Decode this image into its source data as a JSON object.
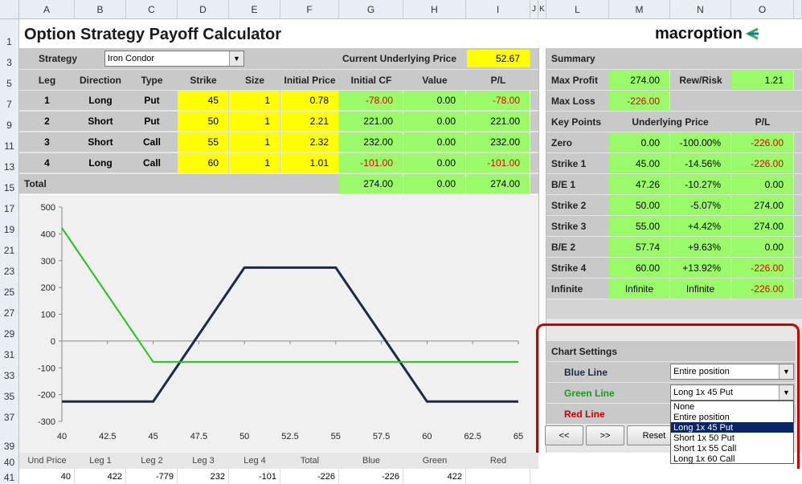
{
  "column_headers": [
    "A",
    "B",
    "C",
    "D",
    "E",
    "F",
    "G",
    "H",
    "I",
    "J",
    "K",
    "L",
    "M",
    "N",
    "O"
  ],
  "row_headers": [
    "1",
    "3",
    "5",
    "7",
    "9",
    "11",
    "13",
    "15",
    "17",
    "19",
    "21",
    "23",
    "25",
    "27",
    "29",
    "31",
    "33",
    "35",
    "37",
    "39",
    "40",
    "41"
  ],
  "title": "Option Strategy Payoff Calculator",
  "logo_text": "macroption",
  "strategy": {
    "label": "Strategy",
    "value": "Iron Condor",
    "underlying_label": "Current Underlying Price",
    "underlying_value": "52.67"
  },
  "legs_header": [
    "Leg",
    "Direction",
    "Type",
    "Strike",
    "Size",
    "Initial Price",
    "Initial CF",
    "Value",
    "P/L"
  ],
  "legs": [
    {
      "leg": "1",
      "direction": "Long",
      "type": "Put",
      "strike": "45",
      "size": "1",
      "price": "0.78",
      "cf": "-78.00",
      "value": "0.00",
      "pl": "-78.00"
    },
    {
      "leg": "2",
      "direction": "Short",
      "type": "Put",
      "strike": "50",
      "size": "1",
      "price": "2.21",
      "cf": "221.00",
      "value": "0.00",
      "pl": "221.00"
    },
    {
      "leg": "3",
      "direction": "Short",
      "type": "Call",
      "strike": "55",
      "size": "1",
      "price": "2.32",
      "cf": "232.00",
      "value": "0.00",
      "pl": "232.00"
    },
    {
      "leg": "4",
      "direction": "Long",
      "type": "Call",
      "strike": "60",
      "size": "1",
      "price": "1.01",
      "cf": "-101.00",
      "value": "0.00",
      "pl": "-101.00"
    }
  ],
  "total": {
    "label": "Total",
    "cf": "274.00",
    "value": "0.00",
    "pl": "274.00"
  },
  "summary": {
    "title": "Summary",
    "max_profit_label": "Max Profit",
    "max_profit": "274.00",
    "rew_risk_label": "Rew/Risk",
    "rew_risk": "1.21",
    "max_loss_label": "Max Loss",
    "max_loss": "-226.00"
  },
  "key_points": {
    "header": [
      "Key Points",
      "Underlying Price",
      "P/L"
    ],
    "rows": [
      {
        "label": "Zero",
        "price": "0.00",
        "pct": "-100.00%",
        "pl": "-226.00"
      },
      {
        "label": "Strike 1",
        "price": "45.00",
        "pct": "-14.56%",
        "pl": "-226.00"
      },
      {
        "label": "B/E 1",
        "price": "47.26",
        "pct": "-10.27%",
        "pl": "0.00"
      },
      {
        "label": "Strike 2",
        "price": "50.00",
        "pct": "-5.07%",
        "pl": "274.00"
      },
      {
        "label": "Strike 3",
        "price": "55.00",
        "pct": "+4.42%",
        "pl": "274.00"
      },
      {
        "label": "B/E 2",
        "price": "57.74",
        "pct": "+9.63%",
        "pl": "0.00"
      },
      {
        "label": "Strike 4",
        "price": "60.00",
        "pct": "+13.92%",
        "pl": "-226.00"
      },
      {
        "label": "Infinite",
        "price": "Infinite",
        "pct": "Infinite",
        "pl": "-226.00"
      }
    ]
  },
  "chart_settings": {
    "title": "Chart Settings",
    "blue_label": "Blue Line",
    "blue_value": "Entire position",
    "green_label": "Green Line",
    "green_value": "Long 1x 45 Put",
    "red_label": "Red Line",
    "options": [
      "None",
      "Entire position",
      "Long 1x 45 Put",
      "Short 1x 50 Put",
      "Short 1x 55 Call",
      "Long 1x 60 Call"
    ],
    "selected_option": "Long 1x 45 Put",
    "btn_prev": "<<",
    "btn_next": ">>",
    "btn_reset": "Reset"
  },
  "bottom_table": {
    "headers": [
      "Und Price",
      "Leg 1",
      "Leg 2",
      "Leg 3",
      "Leg 4",
      "Total",
      "Blue",
      "Green",
      "Red"
    ],
    "values": [
      "40",
      "422",
      "-779",
      "232",
      "-101",
      "-226",
      "-226",
      "422",
      ""
    ]
  },
  "colors": {
    "blue_line": "#1b2a45",
    "green_line": "#22c322",
    "cell_green": "#9bfa6a",
    "cell_yellow": "#ffff00",
    "negative": "#e00000",
    "highlight": "#cc0000"
  },
  "chart_data": {
    "type": "line",
    "x_ticks": [
      "40",
      "42.5",
      "45",
      "47.5",
      "50",
      "52.5",
      "55",
      "57.5",
      "60",
      "62.5",
      "65"
    ],
    "y_ticks": [
      "500",
      "400",
      "300",
      "200",
      "100",
      "0",
      "-100",
      "-200",
      "-300"
    ],
    "xlim": [
      40,
      65
    ],
    "ylim": [
      -300,
      500
    ],
    "series": [
      {
        "color": "#1b2a45",
        "points": [
          [
            40,
            -226
          ],
          [
            45,
            -226
          ],
          [
            47.26,
            0
          ],
          [
            50,
            274
          ],
          [
            55,
            274
          ],
          [
            57.74,
            0
          ],
          [
            60,
            -226
          ],
          [
            65,
            -226
          ]
        ]
      },
      {
        "color": "#22c322",
        "points": [
          [
            40,
            422
          ],
          [
            45,
            -78
          ],
          [
            65,
            -78
          ]
        ]
      }
    ]
  }
}
